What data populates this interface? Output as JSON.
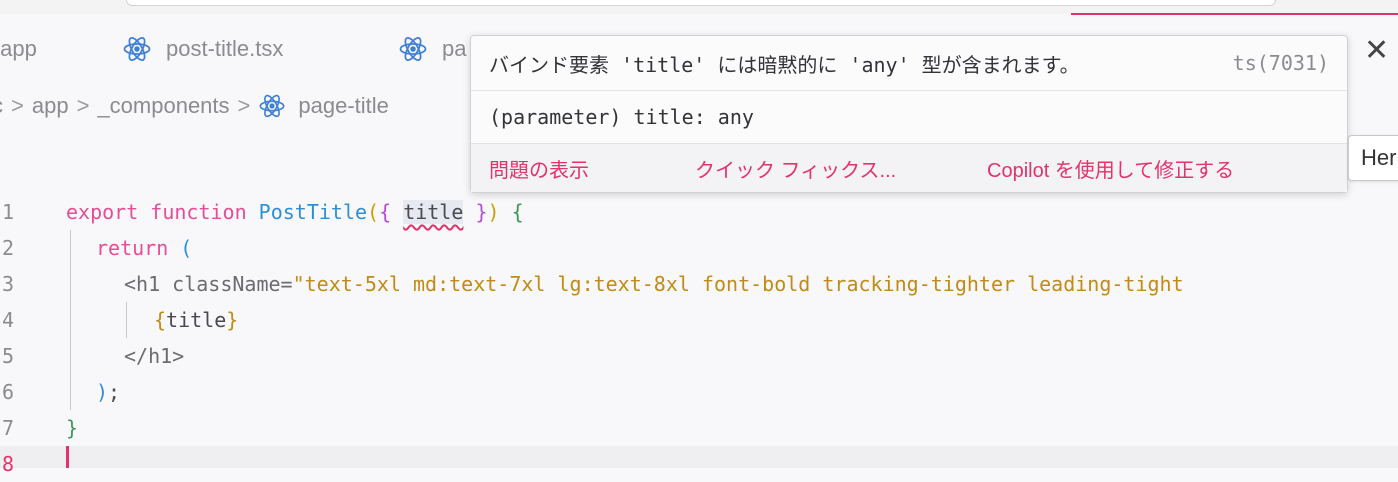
{
  "tabs": [
    {
      "label": "/app",
      "icon": "folder"
    },
    {
      "label": "post-title.tsx",
      "icon": "react-icon"
    },
    {
      "label": "pa",
      "icon": "react-icon"
    }
  ],
  "breadcrumb": {
    "items": [
      "c",
      "app",
      "_components",
      "page-title"
    ],
    "separator": ">"
  },
  "editor": {
    "line_numbers": [
      "1",
      "2",
      "3",
      "4",
      "5",
      "6",
      "7",
      "8"
    ],
    "lines": [
      [
        "export",
        " ",
        "function",
        " ",
        "PostTitle",
        "(",
        "{",
        " ",
        "title",
        " ",
        "}",
        ")",
        " ",
        "{"
      ],
      [
        "return",
        " ",
        "("
      ],
      [
        "<h1 className=",
        "\"text-5xl md:text-7xl lg:text-8xl font-bold tracking-tighter leading-tight"
      ],
      [
        "{",
        "title",
        "}"
      ],
      [
        "</h1>"
      ],
      [
        ")",
        ";"
      ],
      [
        "}"
      ],
      [
        ""
      ]
    ]
  },
  "hover": {
    "message": "バインド要素 'title' には暗黙的に 'any' 型が含まれます。",
    "code": "ts(7031)",
    "signature": "(parameter) title: any",
    "actions": [
      "問題の表示",
      "クイック フィックス...",
      "Copilot を使用して修正する"
    ]
  },
  "close_label": "✕",
  "side_popup_label": "Her",
  "colors": {
    "accent": "#e2336b",
    "keyword": "#e64d97",
    "function": "#2f8fd6",
    "string": "#c08b16",
    "react": "#3f7fd6"
  }
}
